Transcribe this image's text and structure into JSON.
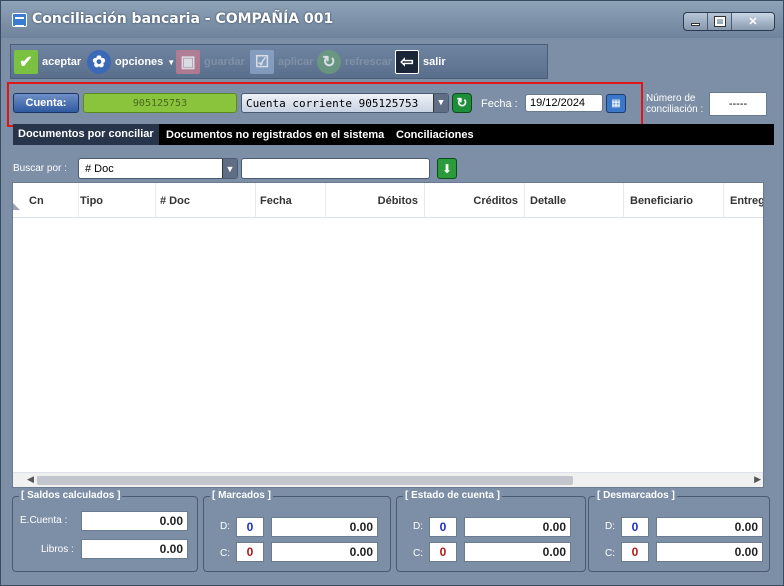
{
  "window": {
    "title": "Conciliación bancaria - COMPAÑÍA 001"
  },
  "toolbar": {
    "aceptar": "aceptar",
    "opciones": "opciones",
    "guardar": "guardar",
    "aplicar": "aplicar",
    "refrescar": "refrescar",
    "salir": "salir"
  },
  "account": {
    "label": "Cuenta:",
    "code": "905125753",
    "selected": "Cuenta corriente 905125753"
  },
  "date": {
    "label": "Fecha :",
    "value": "19/12/2024"
  },
  "reconciliation": {
    "label": "Número de conciliación :",
    "value": "-----"
  },
  "tabs": [
    {
      "label": "Documentos por conciliar"
    },
    {
      "label": "Documentos no registrados en el sistema"
    },
    {
      "label": "Conciliaciones"
    }
  ],
  "search": {
    "label": "Buscar por :",
    "field": "# Doc",
    "value": ""
  },
  "grid": {
    "columns": [
      "Cn",
      "Tipo",
      "# Doc",
      "Fecha",
      "Débitos",
      "Créditos",
      "Detalle",
      "Beneficiario",
      "Entreg"
    ]
  },
  "saldos": {
    "title": "[ Saldos calculados ]",
    "ecuenta_label": "E.Cuenta :",
    "ecuenta_value": "0.00",
    "libros_label": "Libros :",
    "libros_value": "0.00"
  },
  "marcados": {
    "title": "[ Marcados ]",
    "d_label": "D:",
    "d_count": "0",
    "d_value": "0.00",
    "c_label": "C:",
    "c_count": "0",
    "c_value": "0.00"
  },
  "estado": {
    "title": "[ Estado de cuenta ]",
    "d_label": "D:",
    "d_count": "0",
    "d_value": "0.00",
    "c_label": "C:",
    "c_count": "0",
    "c_value": "0.00"
  },
  "desmarcados": {
    "title": "[ Desmarcados ]",
    "d_label": "D:",
    "d_count": "0",
    "d_value": "0.00",
    "c_label": "C:",
    "c_count": "0",
    "c_value": "0.00"
  },
  "colors": {
    "window_bg": "#7c8fa6",
    "highlight": "#e01616",
    "account_green": "#8ac33c",
    "count_blue": "#1c2fc8",
    "count_red": "#b01818"
  }
}
